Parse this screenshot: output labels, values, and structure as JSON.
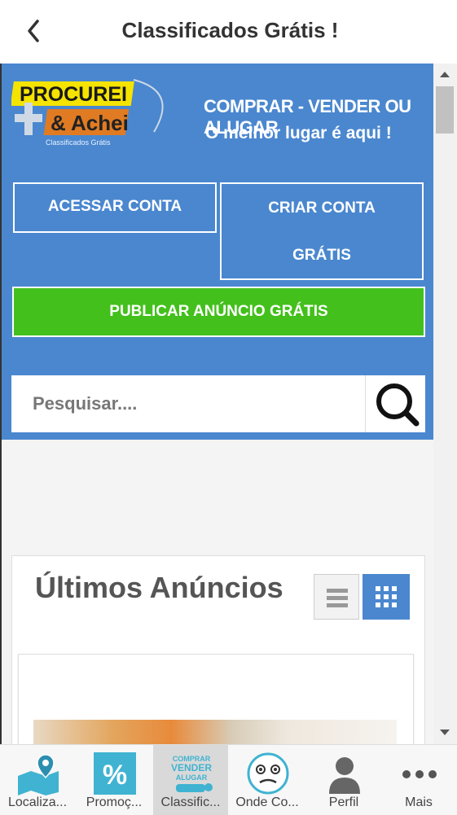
{
  "header": {
    "title": "Classificados Grátis !",
    "back_icon": "chevron-left-icon"
  },
  "logo": {
    "line1": "PROCUREI",
    "line2": "& Achei",
    "line3": "Classificados Grátis"
  },
  "hero": {
    "tagline_1": "COMPRAR - VENDER OU ALUGAR",
    "tagline_2": "O melhor lugar é aqui !",
    "login_label": "ACESSAR CONTA",
    "create_label_1": "CRIAR CONTA",
    "create_label_2": "GRÁTIS",
    "publish_label": "PUBLICAR ANÚNCIO GRÁTIS"
  },
  "search": {
    "placeholder": "Pesquisar....",
    "icon": "search-icon"
  },
  "listing": {
    "title": "Últimos Anúncios",
    "view_list_icon": "list-view-icon",
    "view_grid_icon": "grid-view-icon"
  },
  "colors": {
    "accent": "#4a87cf",
    "publish": "#43c01c",
    "tab_icon": "#3fb3d1"
  },
  "tabs": [
    {
      "label": "Localiza...",
      "icon": "map-pin-icon"
    },
    {
      "label": "Promoç...",
      "icon": "percent-icon"
    },
    {
      "label": "Classific...",
      "icon": "classifieds-icon",
      "mini_1": "COMPRAR",
      "mini_2": "VENDER",
      "mini_3": "ALUGAR"
    },
    {
      "label": "Onde Co...",
      "icon": "face-icon"
    },
    {
      "label": "Perfil",
      "icon": "user-icon"
    },
    {
      "label": "Mais",
      "icon": "more-icon"
    }
  ]
}
